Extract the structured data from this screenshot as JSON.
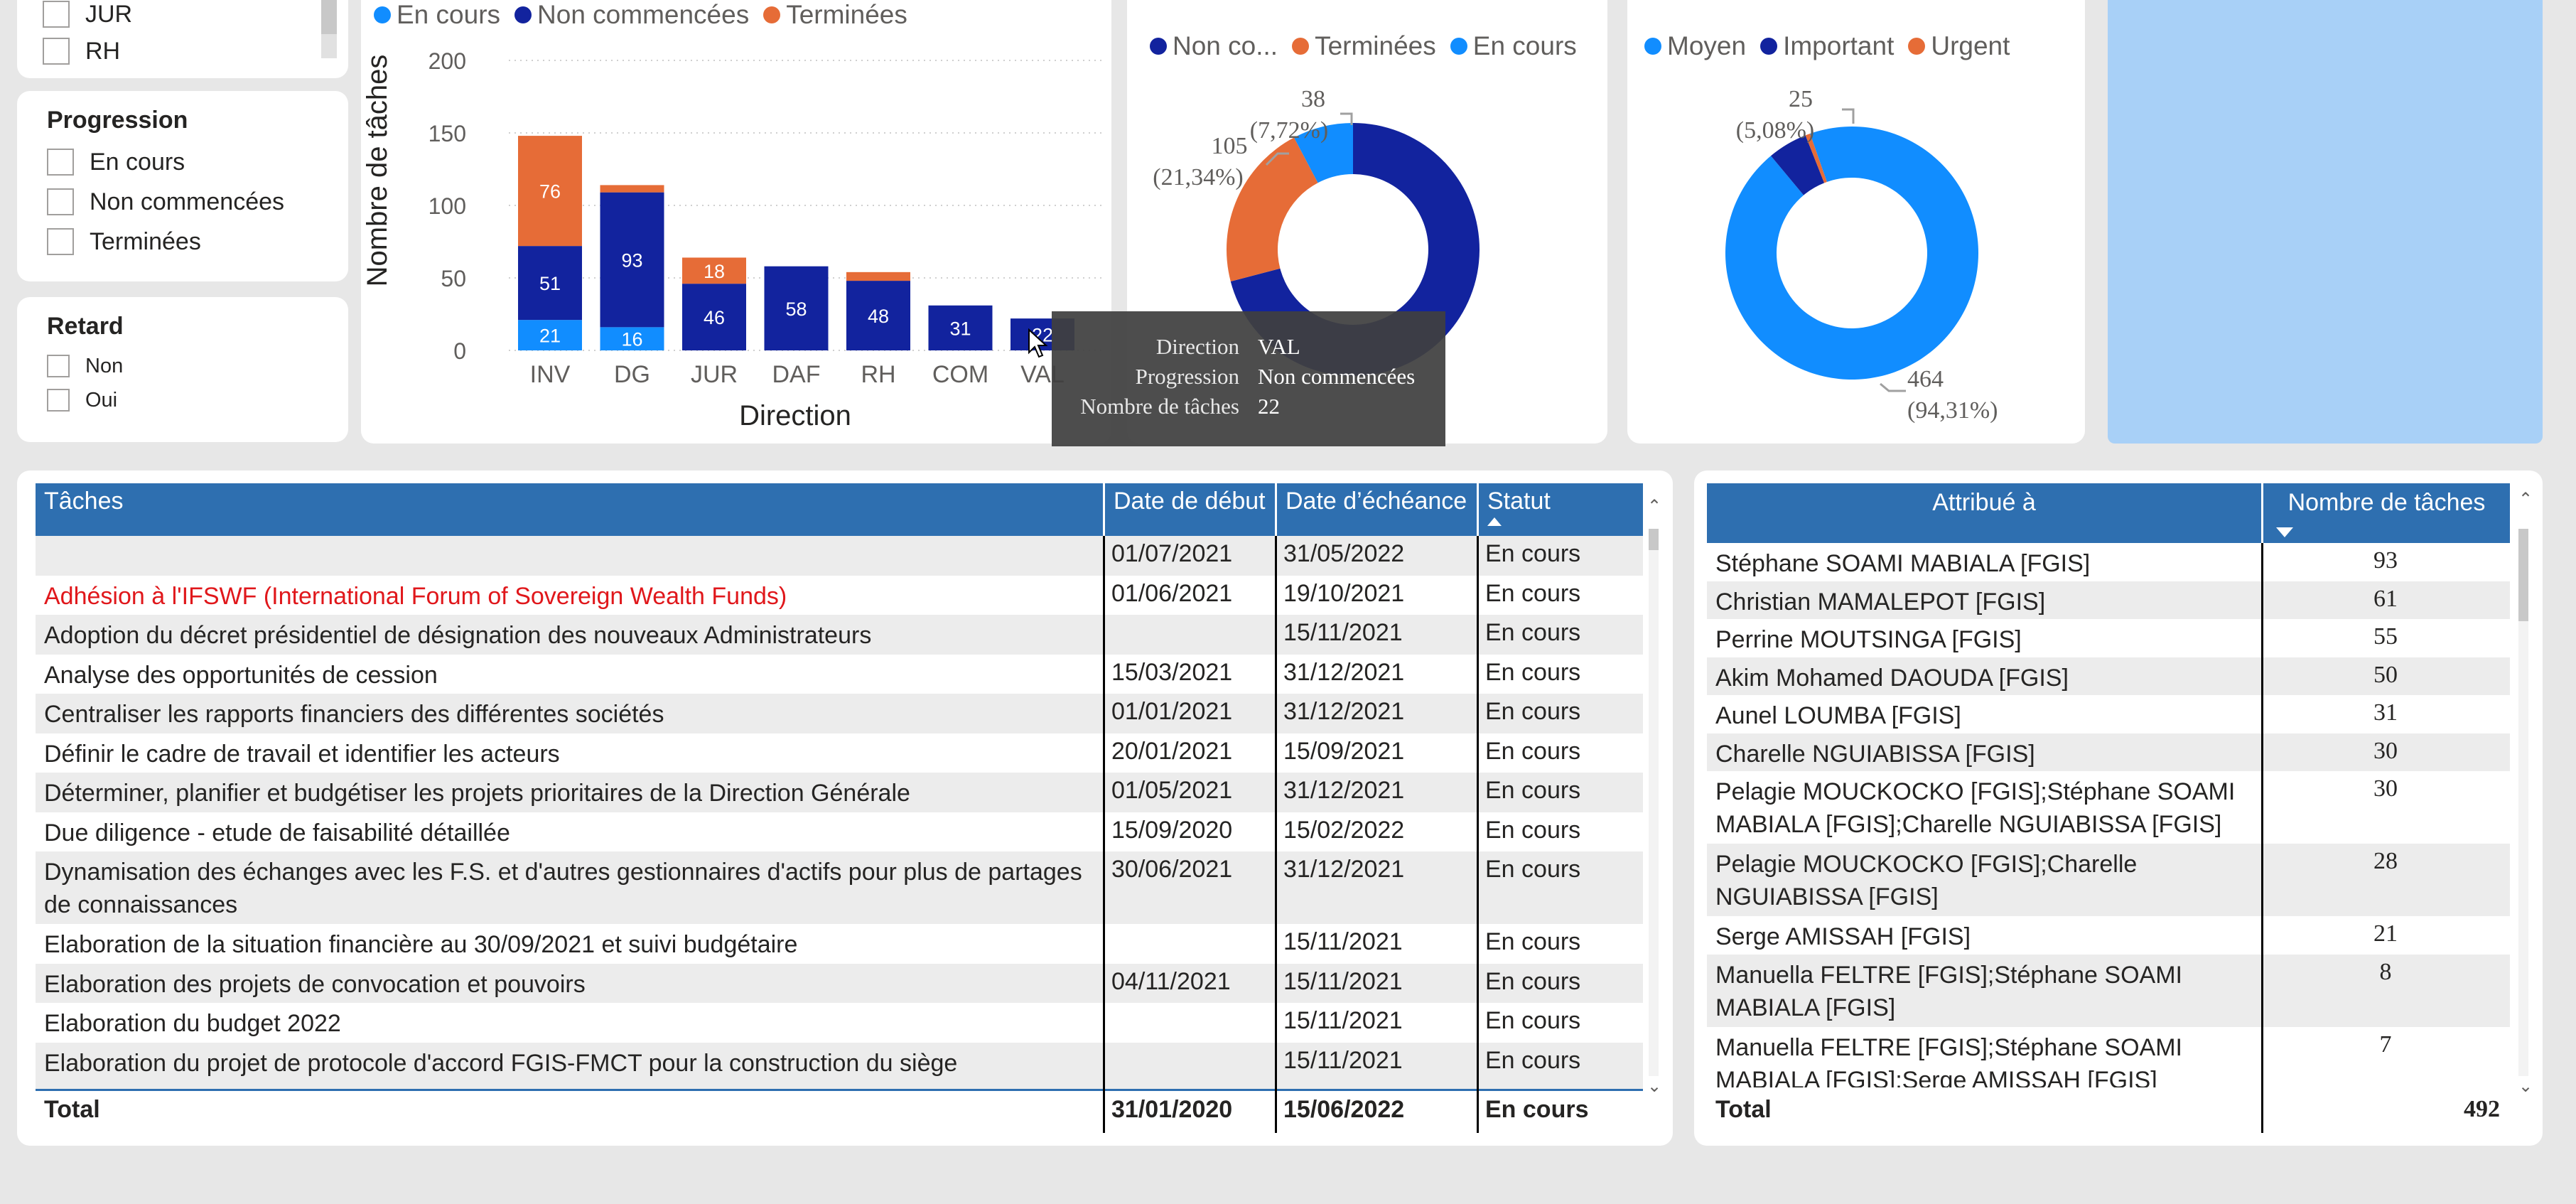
{
  "filters": {
    "direction_partial": {
      "items": [
        "JUR",
        "RH"
      ]
    },
    "progression": {
      "title": "Progression",
      "items": [
        "En cours",
        "Non commencées",
        "Terminées"
      ]
    },
    "retard": {
      "title": "Retard",
      "items": [
        "Non",
        "Oui"
      ]
    }
  },
  "bar_chart": {
    "legend": [
      "En cours",
      "Non commencées",
      "Terminées"
    ],
    "ylabel": "Nombre de tâches",
    "xlabel": "Direction",
    "yticks": [
      "200",
      "150",
      "100",
      "50",
      "0"
    ]
  },
  "donut_progression": {
    "legend": [
      "Non co...",
      "Terminées",
      "En cours"
    ],
    "labels": {
      "a_value": "38",
      "a_pct": "(7,72%)",
      "b_value": "105",
      "b_pct": "(21,34%)"
    }
  },
  "donut_priorite": {
    "legend": [
      "Moyen",
      "Important",
      "Urgent"
    ],
    "labels": {
      "a_value": "25",
      "a_pct": "(5,08%)",
      "b_value": "464",
      "b_pct": "(94,31%)"
    }
  },
  "tooltip": {
    "rows": [
      {
        "key": "Direction",
        "value": "VAL"
      },
      {
        "key": "Progression",
        "value": "Non commencées"
      },
      {
        "key": "Nombre de tâches",
        "value": "22"
      }
    ]
  },
  "tasks_table": {
    "headers": [
      "Tâches",
      "Date de début",
      "Date d’échéance",
      "Statut"
    ],
    "rows": [
      {
        "task": "",
        "start": "01/07/2021",
        "due": "31/05/2022",
        "status": "En cours"
      },
      {
        "task": "Adhésion à l'IFSWF (International Forum of Sovereign Wealth Funds)",
        "start": "01/06/2021",
        "due": "19/10/2021",
        "status": "En cours"
      },
      {
        "task": "Adoption du décret présidentiel de désignation des nouveaux Administrateurs",
        "start": "",
        "due": "15/11/2021",
        "status": "En cours"
      },
      {
        "task": "Analyse des opportunités de cession",
        "start": "15/03/2021",
        "due": "31/12/2021",
        "status": "En cours"
      },
      {
        "task": "Centraliser les rapports financiers des différentes sociétés",
        "start": "01/01/2021",
        "due": "31/12/2021",
        "status": "En cours"
      },
      {
        "task": "Définir le cadre de travail et identifier les acteurs",
        "start": "20/01/2021",
        "due": "15/09/2021",
        "status": "En cours"
      },
      {
        "task": "Déterminer, planifier et budgétiser les projets prioritaires de la Direction Générale",
        "start": "01/05/2021",
        "due": "31/12/2021",
        "status": "En cours"
      },
      {
        "task": "Due diligence - etude de faisabilité détaillée",
        "start": "15/09/2020",
        "due": "15/02/2022",
        "status": "En cours"
      },
      {
        "task": "Dynamisation des échanges avec les F.S. et d'autres gestionnaires d'actifs pour plus de partages de connaissances",
        "start": "30/06/2021",
        "due": "31/12/2021",
        "status": "En cours"
      },
      {
        "task": "Elaboration de la situation financière au 30/09/2021 et suivi budgétaire",
        "start": "",
        "due": "15/11/2021",
        "status": "En cours"
      },
      {
        "task": "Elaboration des projets de convocation et pouvoirs",
        "start": "04/11/2021",
        "due": "15/11/2021",
        "status": "En cours"
      },
      {
        "task": "Elaboration du budget 2022",
        "start": "",
        "due": "15/11/2021",
        "status": "En cours"
      },
      {
        "task": "Elaboration du projet de protocole d'accord FGIS-FMCT pour la construction du siège",
        "start": "",
        "due": "15/11/2021",
        "status": "En cours"
      }
    ],
    "total": {
      "label": "Total",
      "start": "31/01/2020",
      "due": "15/06/2022",
      "status": "En cours"
    }
  },
  "assignee_table": {
    "headers": [
      "Attribué à",
      "Nombre de tâches"
    ],
    "rows": [
      {
        "name": "Stéphane SOAMI MABIALA [FGIS]",
        "count": "93"
      },
      {
        "name": "Christian MAMALEPOT [FGIS]",
        "count": "61"
      },
      {
        "name": "Perrine MOUTSINGA [FGIS]",
        "count": "55"
      },
      {
        "name": "Akim Mohamed DAOUDA [FGIS]",
        "count": "50"
      },
      {
        "name": "Aunel LOUMBA [FGIS]",
        "count": "31"
      },
      {
        "name": "Charelle NGUIABISSA [FGIS]",
        "count": "30"
      },
      {
        "name": "Pelagie MOUCKOCKO [FGIS];Stéphane SOAMI MABIALA [FGIS];Charelle NGUIABISSA [FGIS]",
        "count": "30"
      },
      {
        "name": "Pelagie MOUCKOCKO [FGIS];Charelle NGUIABISSA [FGIS]",
        "count": "28"
      },
      {
        "name": "Serge AMISSAH [FGIS]",
        "count": "21"
      },
      {
        "name": "Manuella FELTRE [FGIS];Stéphane SOAMI MABIALA [FGIS]",
        "count": "8"
      },
      {
        "name": "Manuella FELTRE [FGIS];Stéphane SOAMI MABIALA [FGIS];Serge AMISSAH [FGIS]",
        "count": "7"
      }
    ],
    "total": {
      "label": "Total",
      "count": "492"
    }
  },
  "chart_data": [
    {
      "type": "bar",
      "stacked": true,
      "orientation": "vertical",
      "xlabel": "Direction",
      "ylabel": "Nombre de tâches",
      "ylim": [
        0,
        200
      ],
      "yticks": [
        0,
        50,
        100,
        150,
        200
      ],
      "grid": true,
      "legend_position": "top-left",
      "categories": [
        "INV",
        "DG",
        "JUR",
        "DAF",
        "RH",
        "COM",
        "VAL"
      ],
      "series": [
        {
          "name": "En cours",
          "color": "#118dff",
          "values": [
            21,
            16,
            0,
            0,
            0,
            0,
            0
          ]
        },
        {
          "name": "Non commencées",
          "color": "#12239e",
          "values": [
            51,
            93,
            46,
            58,
            48,
            31,
            22
          ]
        },
        {
          "name": "Terminées",
          "color": "#e66c37",
          "values": [
            76,
            5,
            18,
            0,
            6,
            0,
            0
          ]
        }
      ],
      "data_labels_shown": {
        "INV": [
          21,
          51,
          76
        ],
        "DG": [
          16,
          93
        ],
        "JUR": [
          46,
          18
        ],
        "DAF": [
          58
        ],
        "RH": [
          48
        ],
        "COM": [
          31
        ],
        "VAL": [
          22
        ]
      }
    },
    {
      "type": "pie",
      "donut": true,
      "legend_position": "top-left",
      "slices": [
        {
          "name": "Non commencées",
          "legend_label": "Non co...",
          "color": "#12239e",
          "value": 349
        },
        {
          "name": "Terminées",
          "color": "#e66c37",
          "value": 105,
          "label": "105 (21,34%)"
        },
        {
          "name": "En cours",
          "color": "#118dff",
          "value": 38,
          "label": "38 (7,72%)"
        }
      ]
    },
    {
      "type": "pie",
      "donut": true,
      "legend_position": "top-left",
      "slices": [
        {
          "name": "Moyen",
          "color": "#118dff",
          "value": 464,
          "label": "464 (94,31%)"
        },
        {
          "name": "Important",
          "color": "#12239e",
          "value": 25,
          "label": "25 (5,08%)"
        },
        {
          "name": "Urgent",
          "color": "#e66c37",
          "value": 3
        }
      ]
    }
  ]
}
